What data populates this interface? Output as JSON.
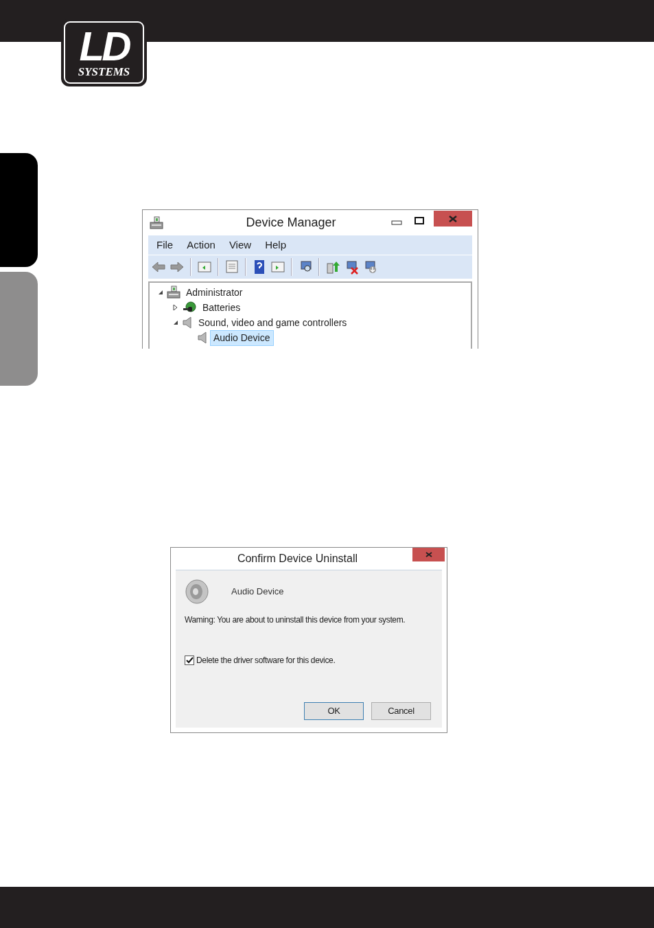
{
  "logo": {
    "mark": "LD",
    "wordmark": "SYSTEMS"
  },
  "side_tabs": [
    {
      "selected": true
    },
    {
      "selected": false
    }
  ],
  "device_manager": {
    "title": "Device Manager",
    "menu": [
      "File",
      "Action",
      "View",
      "Help"
    ],
    "tree": [
      {
        "label": "Administrator",
        "expanded": true,
        "selected": false,
        "children": [
          {
            "label": "Batteries",
            "expanded": false,
            "selected": false
          },
          {
            "label": "Sound, video and game controllers",
            "expanded": true,
            "selected": false,
            "children": [
              {
                "label": "Audio Device",
                "selected": true
              }
            ]
          }
        ]
      }
    ]
  },
  "dialog": {
    "title": "Confirm Device Uninstall",
    "device": "Audio Device",
    "warning": "Waming: You are about to uninstall this device from your system.",
    "checkbox": {
      "label": "Delete the driver software for this device.",
      "checked": true
    },
    "buttons": [
      {
        "label": "OK",
        "selected": true
      },
      {
        "label": "Cancel",
        "selected": false
      }
    ]
  }
}
